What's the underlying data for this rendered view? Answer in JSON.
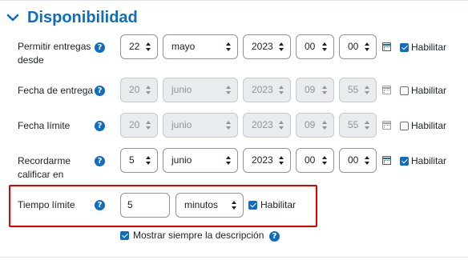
{
  "section": {
    "title": "Disponibilidad",
    "icon": "chevron-down-icon"
  },
  "rows": [
    {
      "label": "Permitir entregas desde",
      "day": "22",
      "month": "mayo",
      "year": "2023",
      "hour": "00",
      "minute": "00",
      "enable_label": "Habilitar",
      "enabled": true
    },
    {
      "label": "Fecha de entrega",
      "day": "20",
      "month": "junio",
      "year": "2023",
      "hour": "09",
      "minute": "55",
      "enable_label": "Habilitar",
      "enabled": false
    },
    {
      "label": "Fecha límite",
      "day": "20",
      "month": "junio",
      "year": "2023",
      "hour": "09",
      "minute": "55",
      "enable_label": "Habilitar",
      "enabled": false
    },
    {
      "label": "Recordarme calificar en",
      "day": "5",
      "month": "junio",
      "year": "2023",
      "hour": "00",
      "minute": "00",
      "enable_label": "Habilitar",
      "enabled": true
    }
  ],
  "time_limit": {
    "label": "Tiempo límite",
    "value": "5",
    "unit": "minutos",
    "enable_label": "Habilitar",
    "enabled": true
  },
  "always_show_description": {
    "label": "Mostrar siempre la descripción",
    "checked": true
  },
  "colors": {
    "accent": "#0f6cbf",
    "highlight_border": "#e30000",
    "disabled_bg": "#e9ecef"
  }
}
